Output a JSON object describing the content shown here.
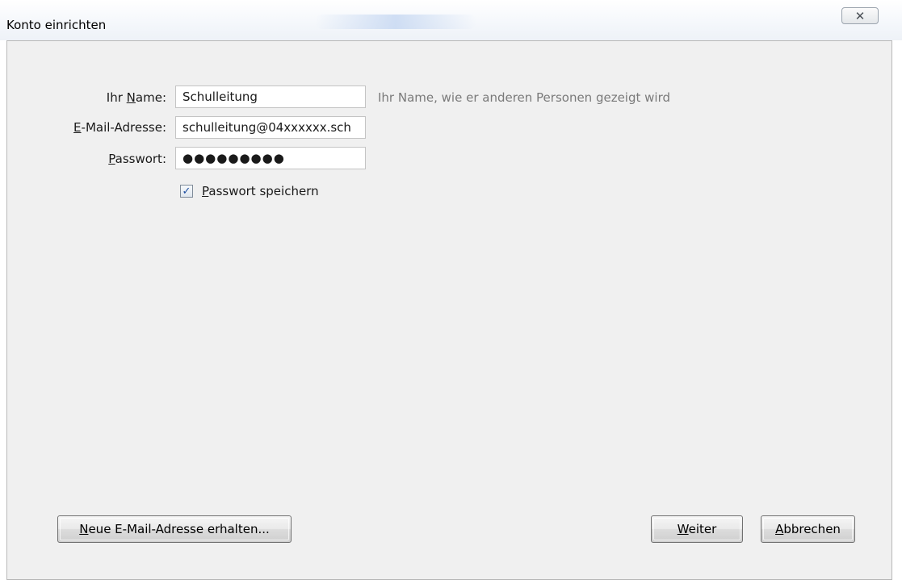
{
  "window": {
    "title": "Konto einrichten",
    "close_symbol": "✕"
  },
  "form": {
    "name_label_pre": "Ihr ",
    "name_label_key": "N",
    "name_label_post": "ame:",
    "name_value": "Schulleitung",
    "name_hint": "Ihr Name, wie er anderen Personen gezeigt wird",
    "email_label_key": "E",
    "email_label_post": "-Mail-Adresse:",
    "email_value": "schulleitung@04xxxxxx.sch",
    "password_label_key": "P",
    "password_label_post": "asswort:",
    "password_value": "●●●●●●●●●",
    "save_password_key": "P",
    "save_password_post": "asswort speichern",
    "save_password_checked": true,
    "checkmark": "✓"
  },
  "buttons": {
    "new_email_key": "N",
    "new_email_post": "eue E-Mail-Adresse erhalten...",
    "next_key": "W",
    "next_post": "eiter",
    "cancel_key": "A",
    "cancel_post": "bbrechen"
  },
  "icons": {
    "close": "close-icon",
    "check": "checkmark-icon"
  }
}
